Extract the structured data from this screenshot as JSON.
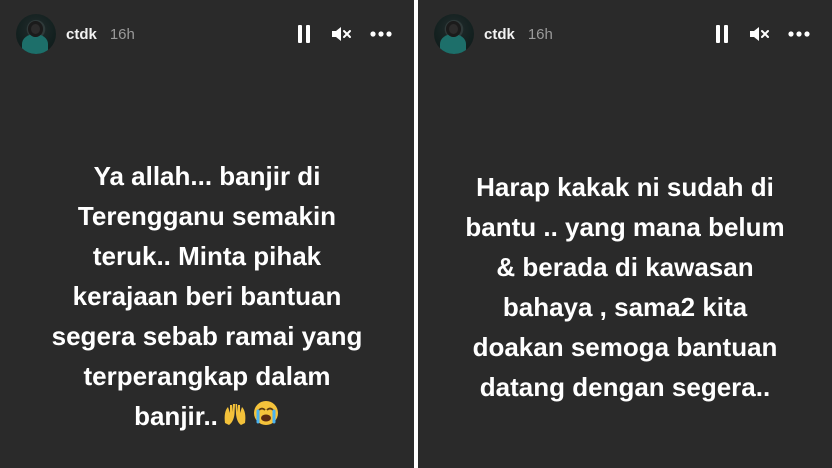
{
  "stories": [
    {
      "username": "ctdk",
      "time": "16h",
      "text": "Ya allah... banjir di\nTerengganu semakin\nteruk.. Minta pihak\nkerajaan beri bantuan\nsegera sebab ramai yang\nterperangkap dalam\nbanjir..",
      "emojis": [
        "raised-hands",
        "crying-face"
      ]
    },
    {
      "username": "ctdk",
      "time": "16h",
      "text": "Harap kakak ni sudah di\nbantu .. yang mana belum\n& berada di kawasan\nbahaya , sama2 kita\ndoakan semoga bantuan\ndatang dengan segera.."
    }
  ],
  "icons": {
    "pause": "pause-icon",
    "mute": "muted-speaker-icon",
    "more": "more-options-icon"
  },
  "colors": {
    "panel_bg": "#2a2a2a",
    "text": "#ffffff",
    "timestamp": "#9a9a9a"
  }
}
